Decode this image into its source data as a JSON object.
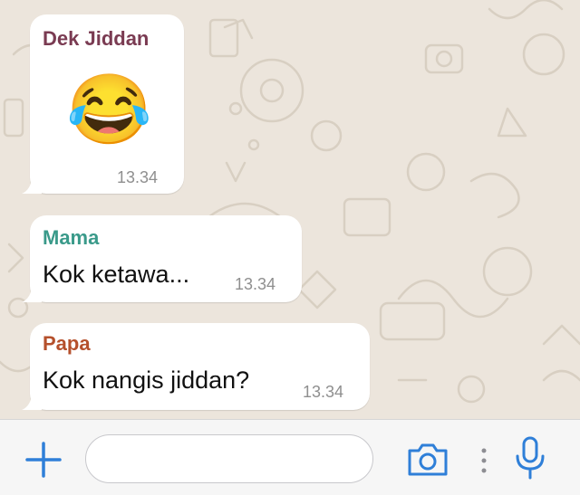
{
  "chat": {
    "messages": [
      {
        "sender": "Dek Jiddan",
        "sender_color": "#7a3b52",
        "emoji": "😂",
        "time": "13.34"
      },
      {
        "sender": "Mama",
        "sender_color": "#3a9a8a",
        "text": "Kok ketawa...",
        "time": "13.34"
      },
      {
        "sender": "Papa",
        "sender_color": "#b5502c",
        "text": "Kok nangis jiddan?",
        "time": "13.34"
      }
    ]
  },
  "input_bar": {
    "placeholder": "",
    "accent_color": "#2f7fd8",
    "icons": [
      "plus-icon",
      "camera-icon",
      "more-dots-icon",
      "microphone-icon"
    ]
  },
  "wallpaper": {
    "color": "#ece5dc",
    "doodle_color": "#d9d0c4"
  }
}
